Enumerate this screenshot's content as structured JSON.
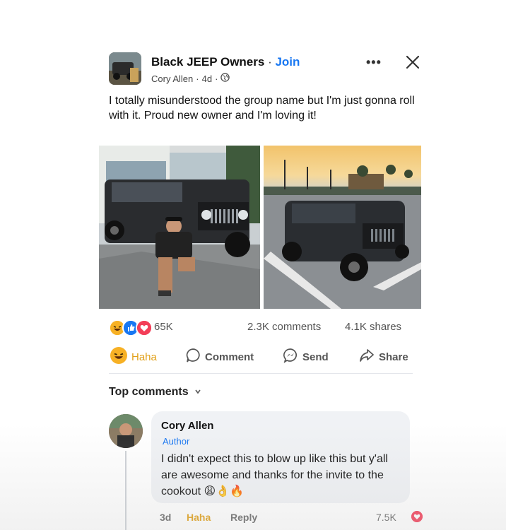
{
  "post": {
    "group_name": "Black JEEP Owners",
    "separator": " · ",
    "join_label": "Join",
    "author": "Cory Allen",
    "time": "4d",
    "text": "I totally misunderstood the group name but I'm just gonna roll with it. Proud new owner and I'm loving it!",
    "more_icon": "more-options-icon",
    "close_icon": "close-icon"
  },
  "stats": {
    "reactions": [
      "haha",
      "like",
      "love"
    ],
    "reaction_count": "65K",
    "comments": "2.3K comments",
    "shares": "4.1K shares"
  },
  "actions": {
    "haha_label": "Haha",
    "comment_label": "Comment",
    "send_label": "Send",
    "share_label": "Share"
  },
  "comments": {
    "sort_label": "Top comments",
    "items": [
      {
        "name": "Cory Allen",
        "badge": "Author",
        "text": "I didn't expect this to blow up like this but y'all are awesome and thanks for the invite to the cookout 😩👌🔥",
        "time": "3d",
        "haha_label": "Haha",
        "reply_label": "Reply",
        "reaction_count": "7.5K"
      }
    ]
  },
  "colors": {
    "accent": "#1877f2",
    "haha": "#f7b125",
    "love": "#f33e58"
  }
}
